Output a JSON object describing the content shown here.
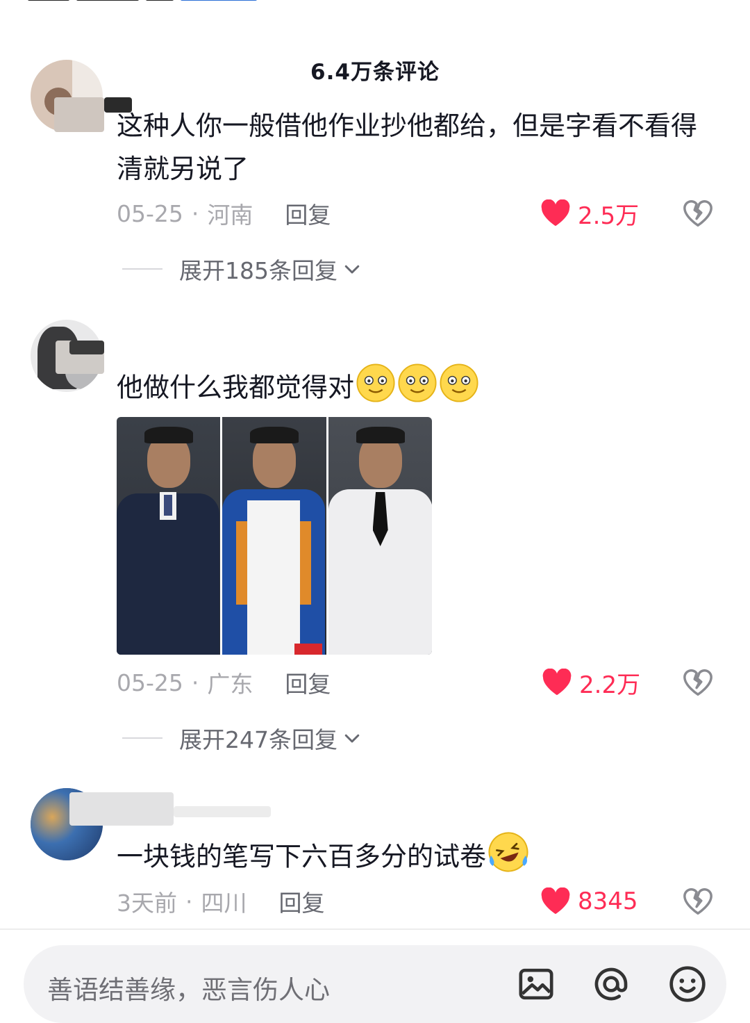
{
  "header": {
    "comment_count": "6.4万条评论"
  },
  "comments": [
    {
      "text": "这种人你一般借他作业抄他都给，但是字看不看得清就另说了",
      "date": "05-25",
      "location": "河南",
      "reply_label": "回复",
      "likes": "2.5万",
      "expand_label": "展开185条回复"
    },
    {
      "text": "他做什么我都觉得对",
      "date": "05-25",
      "location": "广东",
      "reply_label": "回复",
      "likes": "2.2万",
      "expand_label": "展开247条回复"
    },
    {
      "text": "一块钱的笔写下六百多分的试卷",
      "date": "3天前",
      "location": "四川",
      "reply_label": "回复",
      "likes": "8345"
    }
  ],
  "separator": "·",
  "input": {
    "placeholder": "善语结善缘，恶言伤人心"
  },
  "icons": [
    "heart-icon",
    "broken-heart-icon",
    "chevron-down-icon",
    "image-icon",
    "at-icon",
    "emoji-icon"
  ],
  "colors": {
    "like_red": "#fe2c55",
    "meta_gray": "#a8a8ad",
    "text_dark": "#161823"
  }
}
